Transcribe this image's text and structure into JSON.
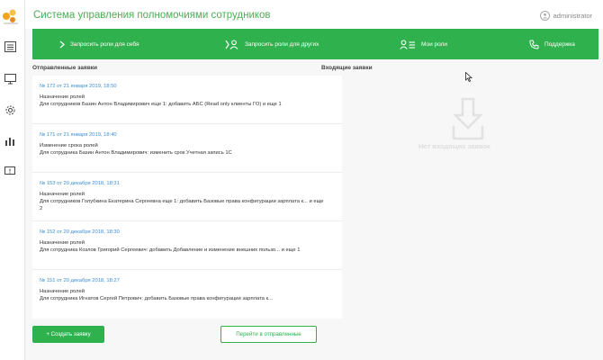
{
  "header": {
    "title": "Система управления полномочиями сотрудников",
    "user": "administrator"
  },
  "nav": [
    {
      "label": "Запросить роли для себя",
      "icon": "chevron-right-icon"
    },
    {
      "label": "Запросить роли для других",
      "icon": "user-arrow-icon"
    },
    {
      "label": "Мои роли",
      "icon": "user-list-icon"
    },
    {
      "label": "Поддержка",
      "icon": "phone-icon"
    }
  ],
  "sent": {
    "title": "Отправленные заявки",
    "items": [
      {
        "link": "№ 172 от 21 января 2019, 18:50",
        "type": "Назначение ролей",
        "desc": "Для сотрудников Базин Антон Владимирович еще 1: добавить АБС (Read only клиенты ГО) и еще 1"
      },
      {
        "link": "№ 171 от 21 января 2019, 18:40",
        "type": "Изменение срока ролей",
        "desc": "Для сотрудника Базин Антон Владимирович: изменить срок Учетная запись 1С"
      },
      {
        "link": "№ 153 от 20 декабря 2018, 18:31",
        "type": "Назначение ролей",
        "desc": "Для сотрудников Голубкина Екатерина Сергеевна еще 1: добавить Базовые права конфигурации зарплата к... и еще 2"
      },
      {
        "link": "№ 152 от 20 декабря 2018, 18:30",
        "type": "Назначение ролей",
        "desc": "Для сотрудника Козлов Григорий Сергеевич: добавить Добавление и изменение внешних пользо... и еще 1"
      },
      {
        "link": "№ 151 от 20 декабря 2018, 18:27",
        "type": "Назначение ролей",
        "desc": "Для сотрудника Игнатов Сергей Петрович: добавить Базовые права конфигурации зарплата к..."
      }
    ]
  },
  "incoming": {
    "title": "Входящие заявки",
    "empty_text": "Нет входящих заявок"
  },
  "buttons": {
    "create": "+ Создать заявку",
    "go_sent": "Перейти в отправленные"
  },
  "colors": {
    "accent": "#2fb24d",
    "link": "#3a8ed8"
  }
}
